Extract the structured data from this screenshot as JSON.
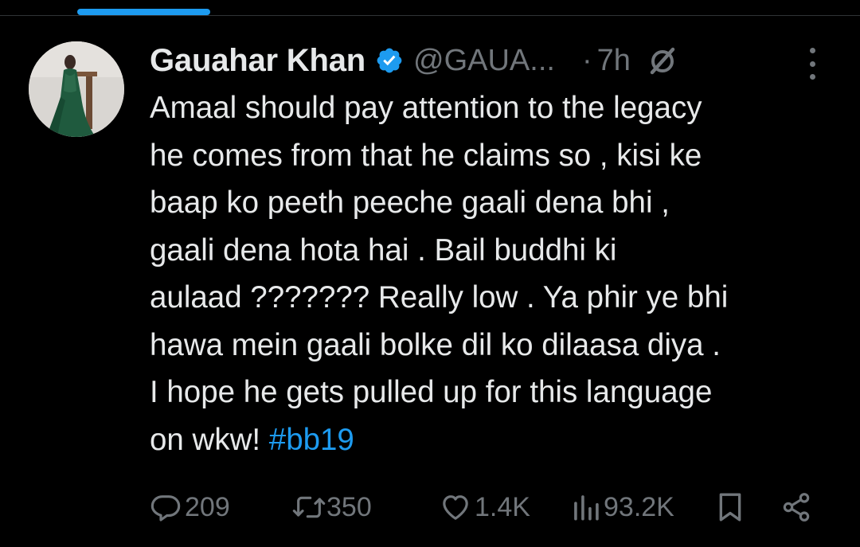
{
  "tweet": {
    "display_name": "Gauahar Khan",
    "handle": "@GAUA...",
    "separator": "·",
    "time": "7h",
    "verified": true,
    "body_lines": [
      "Amaal should pay attention to the legacy",
      "he comes from that he claims so , kisi ke",
      "baap ko peeth peeche gaali dena bhi ,",
      "gaali dena hota hai . Bail buddhi ki",
      "aulaad ??????? Really low . Ya phir ye bhi",
      "hawa mein gaali bolke dil ko dilaasa diya .",
      "I hope he gets pulled up for this language"
    ],
    "last_line_text": "on wkw! ",
    "hashtag": "#bb19"
  },
  "actions": {
    "replies": "209",
    "reposts": "350",
    "likes": "1.4K",
    "views": "93.2K"
  },
  "icons": {
    "verified": "verified-badge-icon",
    "grok": "grok-icon",
    "more": "more-options-icon",
    "reply": "reply-icon",
    "repost": "repost-icon",
    "like": "heart-icon",
    "views": "views-chart-icon",
    "bookmark": "bookmark-icon",
    "share": "share-icon"
  },
  "colors": {
    "background": "#000000",
    "text": "#e7e9ea",
    "muted": "#71767b",
    "accent": "#1d9bf0"
  }
}
